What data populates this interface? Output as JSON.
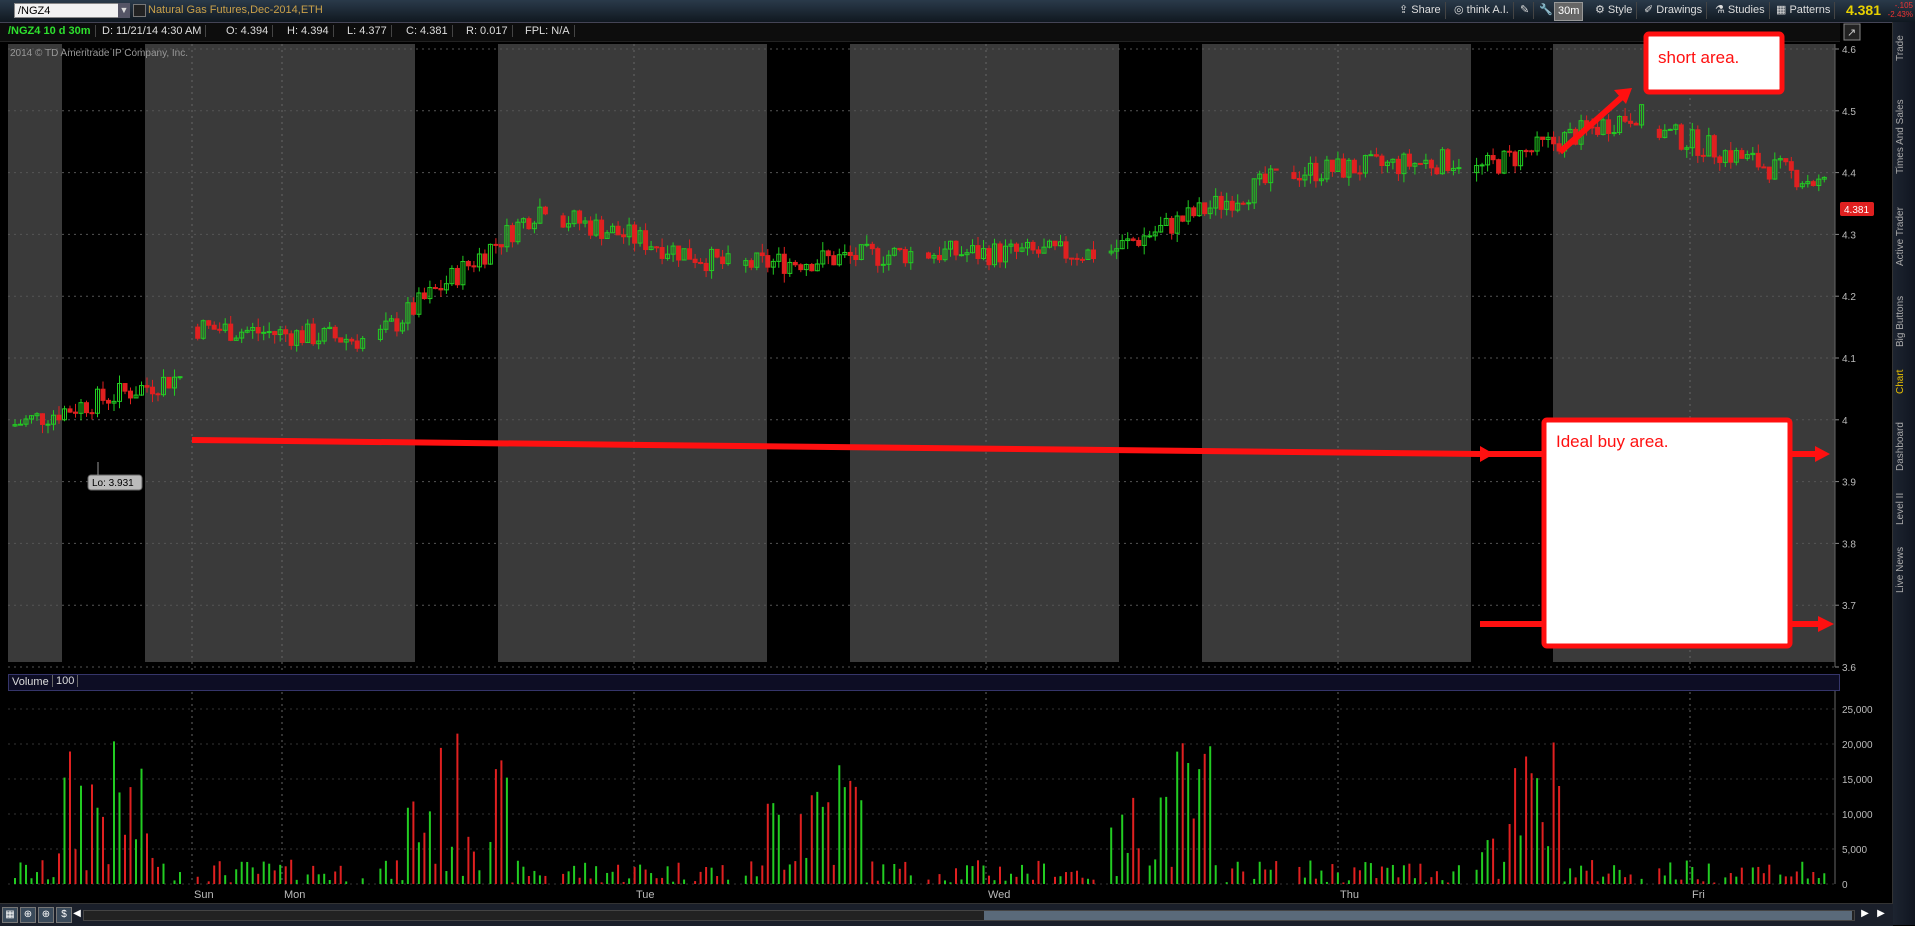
{
  "window": {
    "symbol": "/NGZ4",
    "description": "Natural Gas Futures,Dec-2014,ETH",
    "last_price": "4.381",
    "change_line1": "-.105",
    "change_line2": "-2.43%"
  },
  "toolbar": {
    "share": "Share",
    "think": "think A.I.",
    "interval": "30m",
    "style": "Style",
    "drawings": "Drawings",
    "studies": "Studies",
    "patterns": "Patterns"
  },
  "infobar": {
    "period": "/NGZ4 10 d 30m",
    "date": "D: 11/21/14 4:30 AM",
    "open": "O: 4.394",
    "high": "H: 4.394",
    "low": "L: 4.377",
    "close": "C: 4.381",
    "range": "R: 0.017",
    "fpl": "FPL: N/A"
  },
  "copyright": "2014 © TD Ameritrade IP Company, Inc.",
  "price_axis": {
    "ticks": [
      "4.6",
      "4.5",
      "4.4",
      "4.3",
      "4.2",
      "4.1",
      "4",
      "3.9",
      "3.8",
      "3.7",
      "3.6"
    ],
    "price_badge": "4.381"
  },
  "low_label": "Lo: 3.931",
  "annotations": {
    "short": "short area.",
    "buy": "Ideal buy area."
  },
  "volume": {
    "title": "Volume",
    "value": "100",
    "ticks": [
      "25,000",
      "20,000",
      "15,000",
      "10,000",
      "5,000",
      "0"
    ]
  },
  "time_axis": [
    "Sun",
    "Mon",
    "Tue",
    "Wed",
    "Thu",
    "Fri"
  ],
  "right_tabs": [
    "Trade",
    "Times And Sales",
    "Active Trader",
    "Big Buttons",
    "Chart",
    "Dashboard",
    "Level II",
    "Live News"
  ],
  "colors": {
    "up": "#22cc22",
    "down": "#e02020",
    "annotation": "#ff1010",
    "session_bg": "#3a3a3a",
    "night_bg": "#000000"
  },
  "chart_data": {
    "type": "candlestick",
    "series": [
      {
        "session": 0,
        "start": 3.99,
        "end": 4.07,
        "min": 3.931,
        "max": 4.09
      },
      {
        "session": 1,
        "start": 4.15,
        "end": 4.13,
        "min": 4.11,
        "max": 4.19
      },
      {
        "session": 2,
        "start": 4.13,
        "end": 4.35,
        "min": 4.11,
        "max": 4.36
      },
      {
        "session": 3,
        "start": 4.33,
        "end": 4.25,
        "min": 4.15,
        "max": 4.34
      },
      {
        "session": 4,
        "start": 4.25,
        "end": 4.27,
        "min": 4.15,
        "max": 4.34
      },
      {
        "session": 5,
        "start": 4.27,
        "end": 4.27,
        "min": 4.2,
        "max": 4.31
      },
      {
        "session": 6,
        "start": 4.27,
        "end": 4.39,
        "min": 4.26,
        "max": 4.51
      },
      {
        "session": 7,
        "start": 4.4,
        "end": 4.42,
        "min": 4.37,
        "max": 4.48
      },
      {
        "session": 8,
        "start": 4.4,
        "end": 4.5,
        "min": 4.25,
        "max": 4.51
      },
      {
        "session": 9,
        "start": 4.47,
        "end": 4.38,
        "min": 4.37,
        "max": 4.53
      }
    ],
    "ylim": [
      3.6,
      4.6
    ],
    "volume_ylim": [
      0,
      26000
    ]
  }
}
